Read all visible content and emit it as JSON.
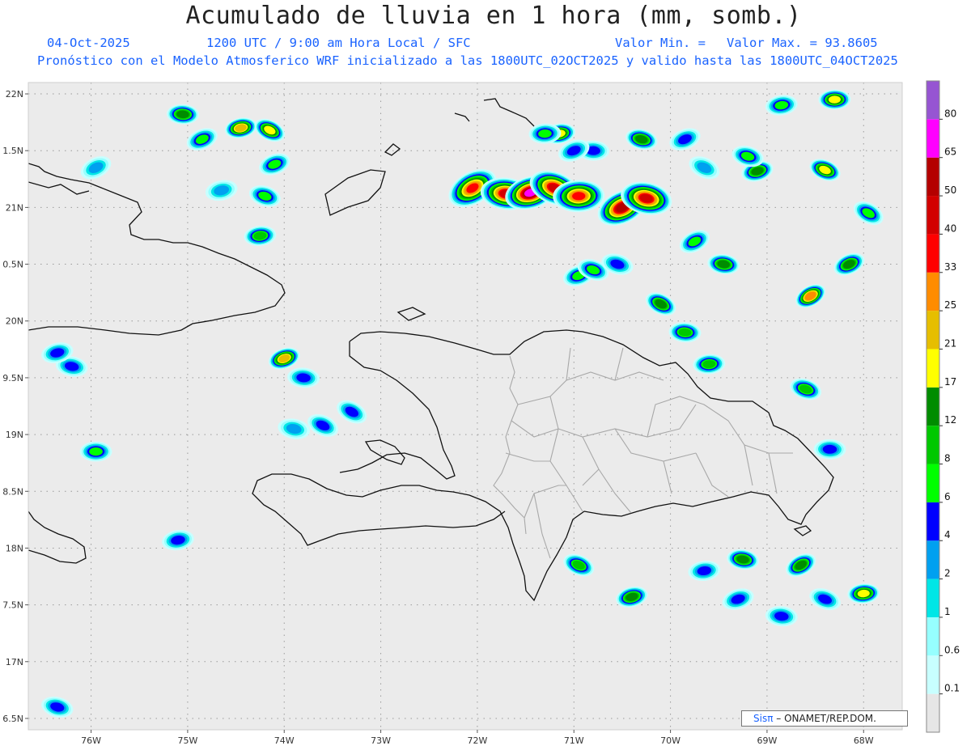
{
  "header": {
    "title": "Acumulado de lluvia en 1 hora (mm, somb.)",
    "date": "04-Oct-2025",
    "time": "1200 UTC / 9:00 am Hora Local / SFC",
    "valor_min": "Valor Min. =",
    "valor_max": "Valor Max. = 93.8605",
    "forecast": "Pronóstico con el Modelo Atmosferico WRF inicializado a las 1800UTC_02OCT2025 y valido hasta las  1800UTC_04OCT2025"
  },
  "map": {
    "lat_range": [
      16.4,
      22.1
    ],
    "lon_range": [
      -76.65,
      -67.6
    ],
    "y_labels": [
      "22N",
      "1.5N",
      "21N",
      "0.5N",
      "20N",
      "9.5N",
      "19N",
      "8.5N",
      "18N",
      "7.5N",
      "17N",
      "6.5N"
    ],
    "x_labels": [
      "76W",
      "75W",
      "74W",
      "73W",
      "72W",
      "71W",
      "70W",
      "69W",
      "68W"
    ],
    "background_color": "#ebebeb",
    "coast_color": "#111111",
    "border_color": "#a8a8a8"
  },
  "colorbar": {
    "labels": [
      "0.1",
      "0.6",
      "1",
      "2",
      "4",
      "6",
      "8",
      "12",
      "17",
      "21",
      "25",
      "33",
      "40",
      "50",
      "65",
      "80"
    ],
    "colors": [
      "#e6e6e6",
      "#c8ffff",
      "#96ffff",
      "#00e6e6",
      "#00a0f0",
      "#0000ff",
      "#00ff00",
      "#00c800",
      "#008c00",
      "#ffff00",
      "#e6be00",
      "#ff8c00",
      "#ff0000",
      "#d20000",
      "#b40000",
      "#ff00ff",
      "#9655d2"
    ]
  },
  "credit": {
    "sis": "Sisπ",
    "org": "– ONAMET/REP.DOM."
  },
  "precip_cells": [
    {
      "lon": -72.05,
      "lat": 21.17,
      "peak": 12
    },
    {
      "lon": -71.7,
      "lat": 21.12,
      "peak": 13
    },
    {
      "lon": -71.45,
      "lat": 21.13,
      "peak": 15
    },
    {
      "lon": -71.2,
      "lat": 21.17,
      "peak": 13
    },
    {
      "lon": -70.95,
      "lat": 21.1,
      "peak": 12
    },
    {
      "lon": -70.5,
      "lat": 21.0,
      "peak": 14
    },
    {
      "lon": -70.25,
      "lat": 21.08,
      "peak": 13
    },
    {
      "lon": -74.45,
      "lat": 21.7,
      "peak": 10
    },
    {
      "lon": -74.15,
      "lat": 21.68,
      "peak": 9
    },
    {
      "lon": -75.05,
      "lat": 21.82,
      "peak": 8
    },
    {
      "lon": -74.1,
      "lat": 21.38,
      "peak": 6
    },
    {
      "lon": -74.2,
      "lat": 21.1,
      "peak": 6
    },
    {
      "lon": -74.25,
      "lat": 20.75,
      "peak": 7
    },
    {
      "lon": -68.55,
      "lat": 20.22,
      "peak": 11
    },
    {
      "lon": -69.45,
      "lat": 20.5,
      "peak": 8
    },
    {
      "lon": -69.1,
      "lat": 21.32,
      "peak": 8
    },
    {
      "lon": -68.4,
      "lat": 21.33,
      "peak": 9
    },
    {
      "lon": -68.3,
      "lat": 21.95,
      "peak": 9
    },
    {
      "lon": -68.15,
      "lat": 20.5,
      "peak": 8
    },
    {
      "lon": -70.3,
      "lat": 21.6,
      "peak": 8
    },
    {
      "lon": -71.15,
      "lat": 21.65,
      "peak": 9
    },
    {
      "lon": -70.1,
      "lat": 20.15,
      "peak": 8
    },
    {
      "lon": -69.85,
      "lat": 19.9,
      "peak": 7
    },
    {
      "lon": -74.0,
      "lat": 19.67,
      "peak": 10
    },
    {
      "lon": -68.6,
      "lat": 19.4,
      "peak": 7
    },
    {
      "lon": -68.0,
      "lat": 17.6,
      "peak": 9
    },
    {
      "lon": -68.65,
      "lat": 17.85,
      "peak": 8
    },
    {
      "lon": -69.25,
      "lat": 17.9,
      "peak": 8
    },
    {
      "lon": -70.4,
      "lat": 17.57,
      "peak": 8
    },
    {
      "lon": -70.95,
      "lat": 17.85,
      "peak": 7
    },
    {
      "lon": -75.95,
      "lat": 18.85,
      "peak": 6
    },
    {
      "lon": -74.85,
      "lat": 21.6,
      "peak": 6
    },
    {
      "lon": -76.35,
      "lat": 16.6,
      "peak": 5
    },
    {
      "lon": -75.1,
      "lat": 18.07,
      "peak": 5
    },
    {
      "lon": -73.3,
      "lat": 19.2,
      "peak": 5
    },
    {
      "lon": -73.8,
      "lat": 19.5,
      "peak": 5
    },
    {
      "lon": -70.95,
      "lat": 20.4,
      "peak": 6
    },
    {
      "lon": -70.8,
      "lat": 20.45,
      "peak": 6
    },
    {
      "lon": -69.6,
      "lat": 19.62,
      "peak": 7
    },
    {
      "lon": -69.75,
      "lat": 20.7,
      "peak": 6
    },
    {
      "lon": -76.2,
      "lat": 19.6,
      "peak": 5
    },
    {
      "lon": -76.35,
      "lat": 19.72,
      "peak": 5
    },
    {
      "lon": -73.6,
      "lat": 19.08,
      "peak": 5
    },
    {
      "lon": -68.35,
      "lat": 18.87,
      "peak": 5
    },
    {
      "lon": -69.85,
      "lat": 21.6,
      "peak": 5
    },
    {
      "lon": -69.2,
      "lat": 21.45,
      "peak": 6
    },
    {
      "lon": -68.85,
      "lat": 21.9,
      "peak": 6
    },
    {
      "lon": -67.95,
      "lat": 20.95,
      "peak": 6
    },
    {
      "lon": -68.85,
      "lat": 17.4,
      "peak": 5
    },
    {
      "lon": -69.3,
      "lat": 17.55,
      "peak": 5
    },
    {
      "lon": -68.4,
      "lat": 17.55,
      "peak": 5
    },
    {
      "lon": -71.3,
      "lat": 21.65,
      "peak": 6
    },
    {
      "lon": -75.95,
      "lat": 21.35,
      "peak": 4
    },
    {
      "lon": -73.9,
      "lat": 19.05,
      "peak": 4
    },
    {
      "lon": -74.65,
      "lat": 21.15,
      "peak": 4
    },
    {
      "lon": -69.65,
      "lat": 21.35,
      "peak": 4
    },
    {
      "lon": -70.8,
      "lat": 21.5,
      "peak": 5
    },
    {
      "lon": -71.0,
      "lat": 21.5,
      "peak": 5
    },
    {
      "lon": -70.55,
      "lat": 20.5,
      "peak": 5
    },
    {
      "lon": -69.65,
      "lat": 17.8,
      "peak": 5
    }
  ]
}
